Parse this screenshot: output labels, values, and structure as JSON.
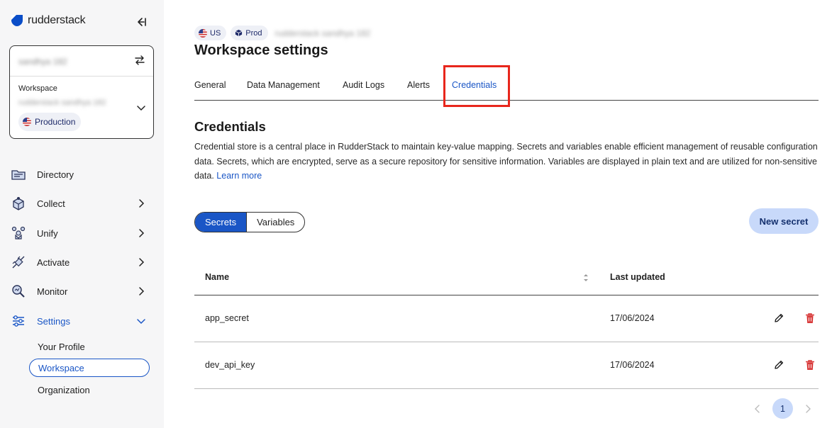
{
  "brand": {
    "name": "rudderstack"
  },
  "sidebar": {
    "current_user": "sandhya 182",
    "workspace_label": "Workspace",
    "workspace_name": "rudderstack sandhya 182",
    "environment": "Production",
    "nav": [
      {
        "label": "Directory"
      },
      {
        "label": "Collect"
      },
      {
        "label": "Unify"
      },
      {
        "label": "Activate"
      },
      {
        "label": "Monitor"
      },
      {
        "label": "Settings"
      }
    ],
    "settings_sub": [
      {
        "label": "Your Profile"
      },
      {
        "label": "Workspace"
      },
      {
        "label": "Organization"
      }
    ]
  },
  "header": {
    "region_badge": "US",
    "env_badge": "Prod",
    "workspace_name": "rudderstack sandhya 182",
    "title": "Workspace settings"
  },
  "tabs": [
    {
      "label": "General"
    },
    {
      "label": "Data Management"
    },
    {
      "label": "Audit Logs"
    },
    {
      "label": "Alerts"
    },
    {
      "label": "Credentials"
    }
  ],
  "credentials": {
    "title": "Credentials",
    "description": "Credential store is a central place in RudderStack to maintain key-value mapping. Secrets and variables enable efficient management of reusable configuration data. Secrets, which are encrypted, serve as a secure repository for sensitive information. Variables are displayed in plain text and are utilized for non-sensitive data.",
    "learn_more": "Learn more",
    "segment": {
      "secrets": "Secrets",
      "variables": "Variables"
    },
    "new_button": "New secret",
    "table": {
      "columns": {
        "name": "Name",
        "updated": "Last updated"
      },
      "rows": [
        {
          "name": "app_secret",
          "updated": "17/06/2024"
        },
        {
          "name": "dev_api_key",
          "updated": "17/06/2024"
        }
      ]
    },
    "pagination": {
      "current_page": "1"
    }
  },
  "colors": {
    "accent": "#1a56c6",
    "highlight": "#e8261c",
    "danger": "#d83a3a"
  }
}
